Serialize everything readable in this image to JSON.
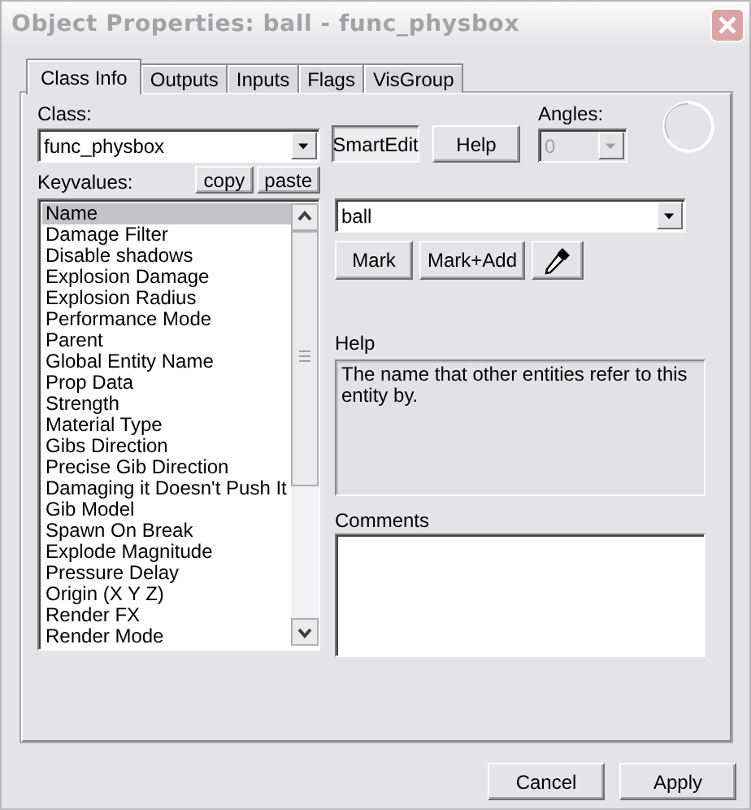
{
  "window": {
    "title": "Object Properties: ball - func_physbox"
  },
  "tabs": [
    {
      "label": "Class Info",
      "selected": true
    },
    {
      "label": "Outputs",
      "selected": false
    },
    {
      "label": "Inputs",
      "selected": false
    },
    {
      "label": "Flags",
      "selected": false
    },
    {
      "label": "VisGroup",
      "selected": false
    }
  ],
  "class_field": {
    "label": "Class:",
    "value": "func_physbox"
  },
  "smartedit_button": {
    "label": "SmartEdit",
    "pressed": true
  },
  "help_button": {
    "label": "Help"
  },
  "angles": {
    "label": "Angles:",
    "value": "0",
    "disabled": true
  },
  "keyvalues": {
    "label": "Keyvalues:",
    "buttons": [
      "copy",
      "paste"
    ],
    "items": [
      {
        "label": "Name",
        "selected": true
      },
      {
        "label": "Damage Filter",
        "selected": false
      },
      {
        "label": "Disable shadows",
        "selected": false
      },
      {
        "label": "Explosion Damage",
        "selected": false
      },
      {
        "label": "Explosion Radius",
        "selected": false
      },
      {
        "label": "Performance Mode",
        "selected": false
      },
      {
        "label": "Parent",
        "selected": false
      },
      {
        "label": "Global Entity Name",
        "selected": false
      },
      {
        "label": "Prop Data",
        "selected": false
      },
      {
        "label": "Strength",
        "selected": false
      },
      {
        "label": "Material Type",
        "selected": false
      },
      {
        "label": "Gibs Direction",
        "selected": false
      },
      {
        "label": "Precise Gib Direction",
        "selected": false
      },
      {
        "label": "Damaging it Doesn't Push It",
        "selected": false
      },
      {
        "label": "Gib Model",
        "selected": false
      },
      {
        "label": "Spawn On Break",
        "selected": false
      },
      {
        "label": "Explode Magnitude",
        "selected": false
      },
      {
        "label": "Pressure Delay",
        "selected": false
      },
      {
        "label": "Origin (X Y Z)",
        "selected": false
      },
      {
        "label": "Render FX",
        "selected": false
      },
      {
        "label": "Render Mode",
        "selected": false
      }
    ]
  },
  "value_field": {
    "value": "ball"
  },
  "value_buttons": [
    "Mark",
    "Mark+Add"
  ],
  "help": {
    "label": "Help",
    "text": "The name that other entities refer to this entity by."
  },
  "comments": {
    "label": "Comments"
  },
  "footer_buttons": [
    "Cancel",
    "Apply"
  ]
}
